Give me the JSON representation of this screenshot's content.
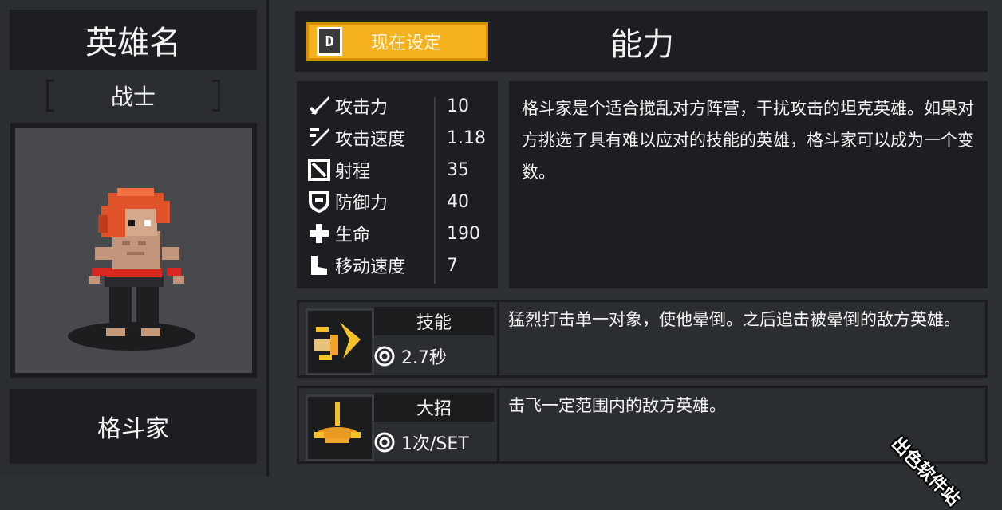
{
  "hero_panel": {
    "title": "英雄名",
    "class_label": "战士",
    "hero_name": "格斗家"
  },
  "ability_header": {
    "preset_key": "D",
    "preset_label": "现在设定",
    "title": "能力"
  },
  "stats": [
    {
      "icon": "sword-icon",
      "label": "攻击力",
      "value": "10"
    },
    {
      "icon": "attack-speed-icon",
      "label": "攻击速度",
      "value": "1.18"
    },
    {
      "icon": "range-icon",
      "label": "射程",
      "value": "35"
    },
    {
      "icon": "shield-icon",
      "label": "防御力",
      "value": "40"
    },
    {
      "icon": "health-cross-icon",
      "label": "生命",
      "value": "190"
    },
    {
      "icon": "boot-icon",
      "label": "移动速度",
      "value": "7"
    }
  ],
  "description": "格斗家是个适合搅乱对方阵营，干扰攻击的坦克英雄。如果对方挑选了具有难以应对的技能的英雄，格斗家可以成为一个变数。",
  "skill": {
    "name": "技能",
    "cooldown": "2.7秒",
    "description": "猛烈打击单一对象，使他晕倒。之后追击被晕倒的敌方英雄。"
  },
  "ultimate": {
    "name": "大招",
    "cooldown": "1次/SET",
    "description": "击飞一定范围内的敌方英雄。"
  },
  "watermark": "出色软件站",
  "colors": {
    "accent": "#f6b21c",
    "panel_dark": "#1c1e21",
    "background": "#2e3134"
  }
}
